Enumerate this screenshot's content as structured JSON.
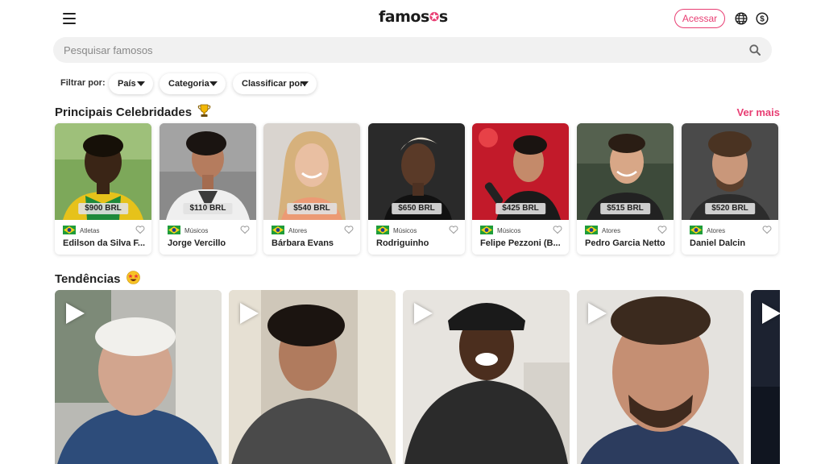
{
  "header": {
    "logo_text_pre": "famos",
    "logo_text_star": "✪",
    "logo_text_post": "s",
    "login_label": "Acessar",
    "icons": [
      "menu-icon",
      "globe-icon",
      "dollar-icon"
    ]
  },
  "search": {
    "placeholder": "Pesquisar famosos"
  },
  "filters": {
    "label": "Filtrar por:",
    "chips": [
      {
        "label": "País"
      },
      {
        "label": "Categoria"
      },
      {
        "label": "Classificar por:"
      }
    ]
  },
  "top_section": {
    "title": "Principais Celebridades",
    "title_emoji": "trophy-icon",
    "see_more": "Ver mais",
    "cards": [
      {
        "price": "$900 BRL",
        "category": "Atletas",
        "name": "Edilson da Silva F..."
      },
      {
        "price": "$110 BRL",
        "category": "Músicos",
        "name": "Jorge Vercillo"
      },
      {
        "price": "$540 BRL",
        "category": "Atores",
        "name": "Bárbara Evans"
      },
      {
        "price": "$650 BRL",
        "category": "Músicos",
        "name": "Rodriguinho"
      },
      {
        "price": "$425 BRL",
        "category": "Músicos",
        "name": "Felipe Pezzoni (B..."
      },
      {
        "price": "$515 BRL",
        "category": "Atores",
        "name": "Pedro Garcia Netto"
      },
      {
        "price": "$520 BRL",
        "category": "Atores",
        "name": "Daniel Dalcin"
      }
    ]
  },
  "trending_section": {
    "title": "Tendências",
    "title_emoji": "star-struck-emoji-icon"
  },
  "colors": {
    "accent": "#e83e73",
    "flag_green": "#1f9d3a",
    "flag_yellow": "#f7d117",
    "flag_blue": "#1d3f93"
  }
}
